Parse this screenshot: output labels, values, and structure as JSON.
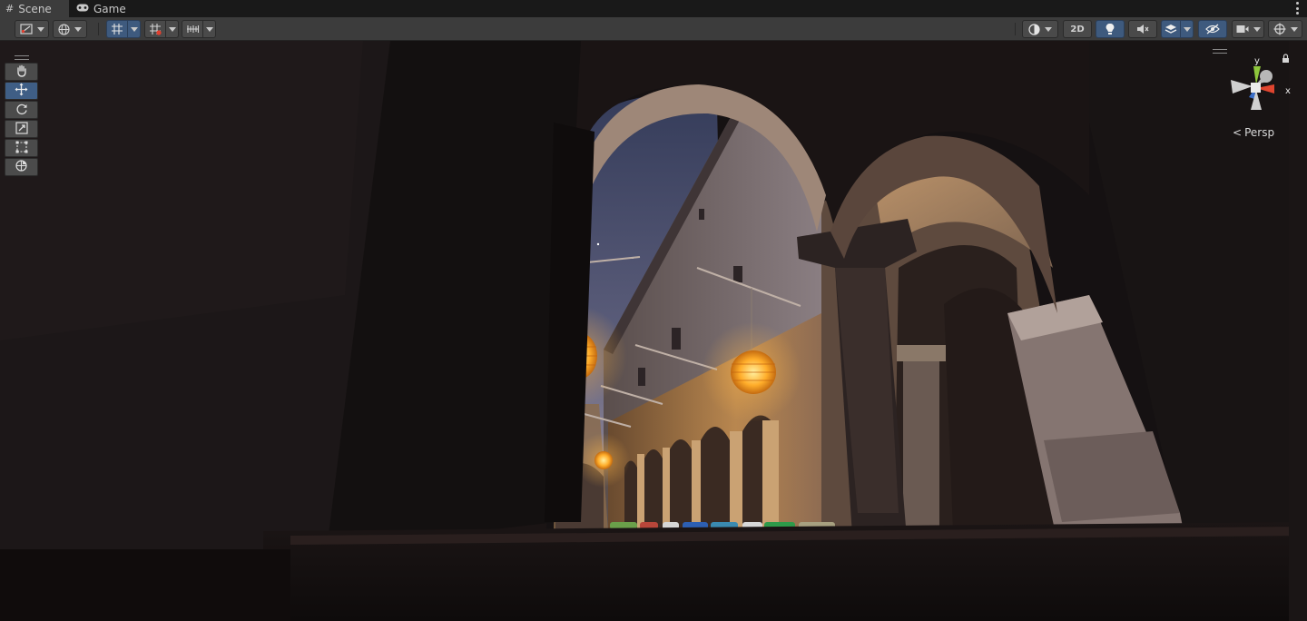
{
  "tabs": [
    {
      "label": "Scene",
      "icon": "grid-hash-icon",
      "active": true
    },
    {
      "label": "Game",
      "icon": "gamepad-icon",
      "active": false
    }
  ],
  "toolbar": {
    "left": [
      {
        "name": "draw-mode",
        "icon": "draw-mode-icon",
        "dropdown": true
      },
      {
        "name": "global-toggle",
        "icon": "globe-icon",
        "dropdown": true
      },
      {
        "name": "grid-snapping",
        "icon": "grid-snap-icon",
        "dropdown": true,
        "active": true
      },
      {
        "name": "grid-visibility",
        "icon": "grid-icon",
        "dropdown": true
      },
      {
        "name": "increment-snap",
        "icon": "ruler-icon",
        "dropdown": true
      }
    ],
    "right": [
      {
        "name": "shading-mode",
        "icon": "sphere-icon",
        "dropdown": true
      },
      {
        "name": "2d-toggle",
        "label": "2D"
      },
      {
        "name": "lighting-toggle",
        "icon": "lightbulb-icon",
        "active": true
      },
      {
        "name": "audio-toggle",
        "icon": "audio-mute-icon"
      },
      {
        "name": "effects-toggle",
        "icon": "layers-icon",
        "dropdown": true,
        "active": true
      },
      {
        "name": "hidden-objects-toggle",
        "icon": "eye-slash-icon",
        "active": true
      },
      {
        "name": "camera-settings",
        "icon": "camera-icon",
        "dropdown": true
      },
      {
        "name": "gizmos",
        "icon": "gizmo-icon",
        "dropdown": true
      }
    ],
    "label_2d": "2D"
  },
  "tools": [
    {
      "name": "view-tool",
      "icon": "hand-icon",
      "active": false
    },
    {
      "name": "move-tool",
      "icon": "move-arrows-icon",
      "active": true
    },
    {
      "name": "rotate-tool",
      "icon": "rotate-icon",
      "active": false
    },
    {
      "name": "scale-tool",
      "icon": "scale-icon",
      "active": false
    },
    {
      "name": "rect-tool",
      "icon": "rect-icon",
      "active": false
    },
    {
      "name": "transform-tool",
      "icon": "transform-icon",
      "active": false
    }
  ],
  "gizmo": {
    "axis_y": "y",
    "axis_x": "x",
    "projection": "Persp",
    "colors": {
      "x": "#e0452f",
      "y": "#8ec73c",
      "z": "#3a6ec8"
    }
  },
  "colors": {
    "accent": "#3e5a7e",
    "lantern": "#ffb23a",
    "sky_top": "#3b4260",
    "sky_bottom": "#9e8ea3"
  }
}
